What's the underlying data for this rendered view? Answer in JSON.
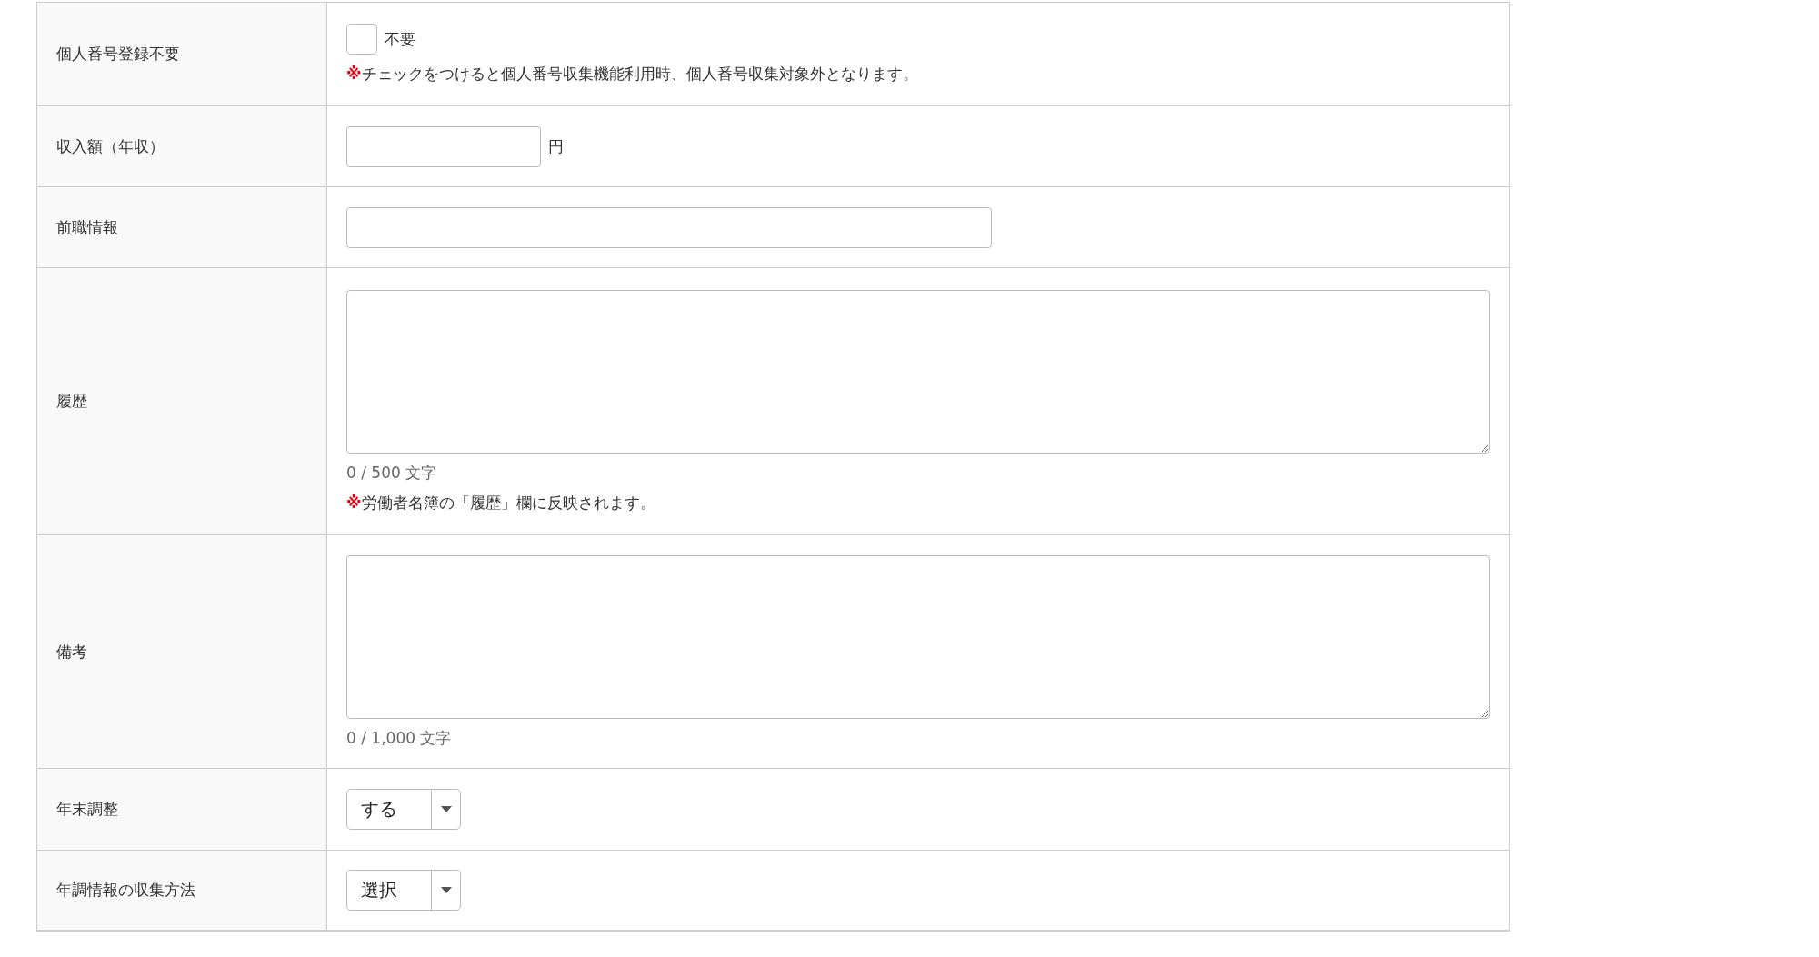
{
  "rows": [
    {
      "kind": "checkbox",
      "label": "個人番号登録不要",
      "checkbox_label": "不要",
      "checked": false,
      "note": {
        "mark": "※",
        "text": "チェックをつけると個人番号収集機能利用時、個人番号収集対象外となります。"
      }
    },
    {
      "kind": "amount",
      "label": "収入額（年収）",
      "unit": "円"
    },
    {
      "kind": "text",
      "label": "前職情報"
    },
    {
      "kind": "textarea",
      "label": "履歴",
      "counter": "0 / 500 文字",
      "note": {
        "mark": "※",
        "text": "労働者名簿の「履歴」欄に反映されます。"
      }
    },
    {
      "kind": "textarea",
      "label": "備考",
      "counter": "0 / 1,000 文字"
    },
    {
      "kind": "select",
      "label": "年末調整",
      "value": "する"
    },
    {
      "kind": "select",
      "label": "年調情報の収集方法",
      "value": "選択"
    }
  ]
}
